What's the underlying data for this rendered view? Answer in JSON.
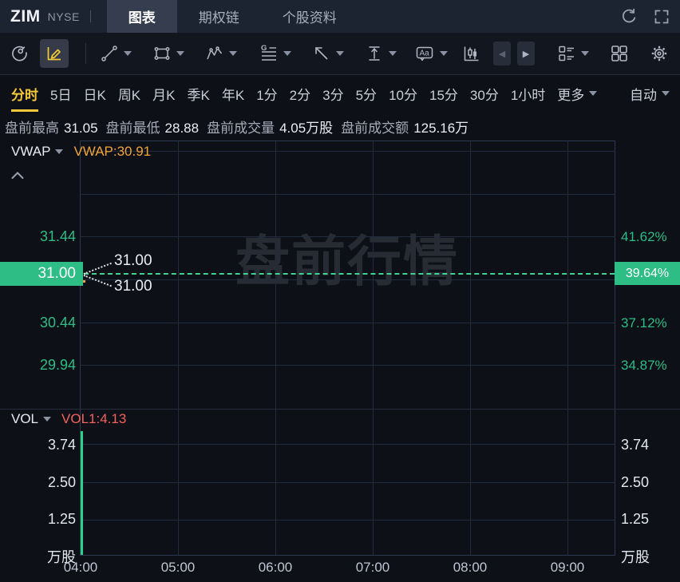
{
  "topbar": {
    "symbol": "ZIM",
    "exchange": "NYSE",
    "tabs": [
      {
        "label": "图表",
        "active": true
      },
      {
        "label": "期权链",
        "active": false
      },
      {
        "label": "个股资料",
        "active": false
      }
    ]
  },
  "toolbar": {
    "prev_icon": "◀",
    "next_icon": "▶"
  },
  "periods": {
    "items": [
      "分时",
      "5日",
      "日K",
      "周K",
      "月K",
      "季K",
      "年K",
      "1分",
      "2分",
      "3分",
      "5分",
      "10分",
      "15分",
      "30分",
      "1小时"
    ],
    "active": "分时",
    "more_label": "更多",
    "auto_label": "自动"
  },
  "stats": [
    {
      "label": "盘前最高",
      "value": "31.05"
    },
    {
      "label": "盘前最低",
      "value": "28.88"
    },
    {
      "label": "盘前成交量",
      "value": "4.05万股"
    },
    {
      "label": "盘前成交额",
      "value": "125.16万"
    }
  ],
  "main_pane": {
    "indicator": "VWAP",
    "indicator_value": "VWAP:30.91",
    "watermark": "盘前行情",
    "left_axis": [
      "31.44",
      "30.44",
      "29.94"
    ],
    "right_axis": [
      "41.62%",
      "37.12%",
      "34.87%"
    ],
    "price_badge": "31.00",
    "change_badge": "39.64%",
    "callout_top": "31.00",
    "callout_bottom": "31.00"
  },
  "vol_pane": {
    "indicator": "VOL",
    "indicator_value": "VOL1:4.13",
    "left_axis": [
      "3.74",
      "2.50",
      "1.25",
      "万股"
    ],
    "right_axis": [
      "3.74",
      "2.50",
      "1.25",
      "万股"
    ]
  },
  "x_axis": [
    "04:00",
    "05:00",
    "06:00",
    "07:00",
    "08:00",
    "09:00"
  ],
  "colors": {
    "up_green": "#2ebd85",
    "accent_yellow": "#f6c73b",
    "vwap_orange": "#f2a43c",
    "volume_red": "#f4625e"
  },
  "chart_data": [
    {
      "type": "line",
      "title": "ZIM 盘前分时 pre-market intraday",
      "x_ticks": [
        "04:00",
        "05:00",
        "06:00",
        "07:00",
        "08:00",
        "09:00"
      ],
      "x": [
        "04:00"
      ],
      "series": [
        {
          "name": "price",
          "values": [
            31.0
          ]
        },
        {
          "name": "VWAP",
          "values": [
            30.91
          ]
        }
      ],
      "y_axis_left_ticks": [
        31.44,
        30.44,
        29.94
      ],
      "y_axis_right_ticks_percent": [
        41.62,
        37.12,
        34.87
      ],
      "current_price": 31.0,
      "current_change_percent": 39.64,
      "session_high": 31.05,
      "session_low": 28.88,
      "grid": true,
      "legend_position": "top-left"
    },
    {
      "type": "bar",
      "title": "VOL 成交量",
      "x": [
        "04:00"
      ],
      "values": [
        4.13
      ],
      "y_ticks": [
        3.74,
        2.5,
        1.25
      ],
      "unit": "万股",
      "bar_color": "#2ebd85"
    }
  ]
}
